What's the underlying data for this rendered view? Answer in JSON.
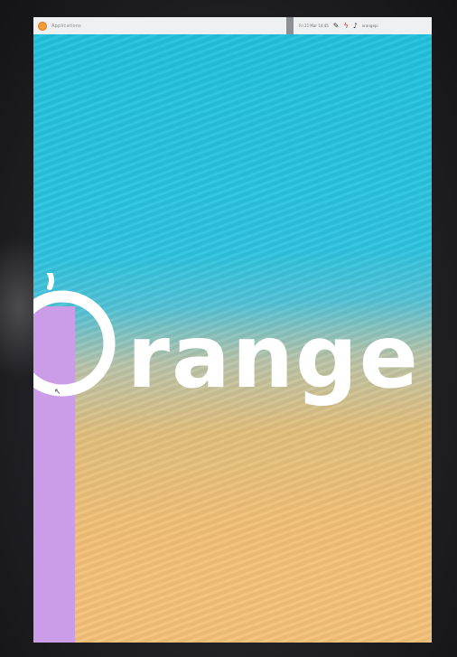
{
  "taskbar": {
    "apps_label": "Applications",
    "tray_text": "Fri 21 Mar 14:45",
    "user_label": "orangepi"
  },
  "wallpaper": {
    "logo_text": "Orange p"
  },
  "colors": {
    "sky": "#1fc1dd",
    "sand": "#f4c27a",
    "panel": "#cb9ce8",
    "taskbar": "#eef0f1",
    "logo": "#ffffff"
  },
  "icons": {
    "app_menu": "orange-logo-icon",
    "pen": "pen-icon",
    "network": "network-icon",
    "volume": "volume-icon"
  }
}
